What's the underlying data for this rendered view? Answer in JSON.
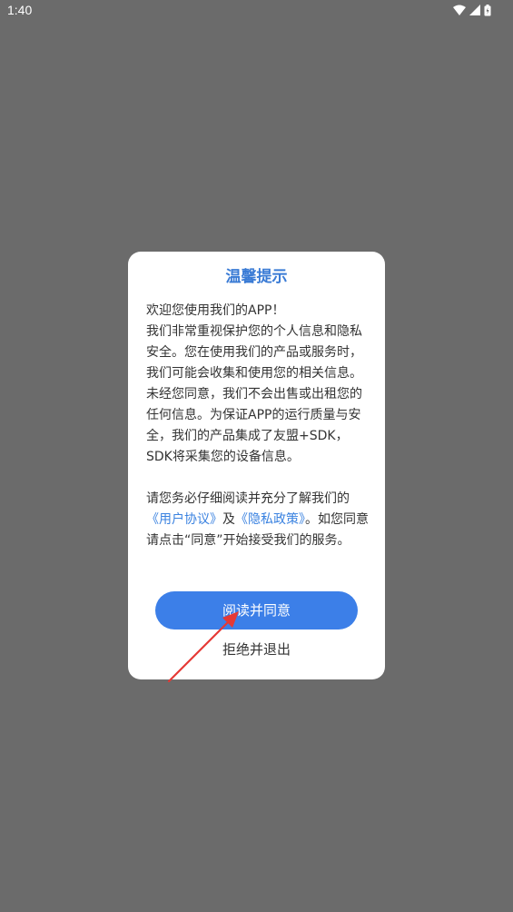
{
  "status_bar": {
    "time": "1:40",
    "icons": [
      "wifi-icon",
      "signal-icon",
      "battery-icon"
    ]
  },
  "dialog": {
    "title": "温馨提示",
    "intro": "欢迎您使用我们的APP！",
    "body": "我们非常重视保护您的个人信息和隐私安全。您在使用我们的产品或服务时，我们可能会收集和使用您的相关信息。未经您同意，我们不会出售或出租您的任何信息。为保证APP的运行质量与安全，我们的产品集成了友盟+SDK，SDK将采集您的设备信息。",
    "consent_prefix": "请您务必仔细阅读并充分了解我们的",
    "user_agreement_link": "《用户协议》",
    "and_text": "及",
    "privacy_policy_link": "《隐私政策》",
    "consent_suffix": "。如您同意请点击“同意”开始接受我们的服务。",
    "agree_button": "阅读并同意",
    "exit_button": "拒绝并退出"
  },
  "colors": {
    "accent": "#3c7fe8",
    "title": "#3a7bd5",
    "link": "#3a82e0",
    "overlay": "#6b6b6b",
    "annotation_arrow": "#e53935"
  }
}
